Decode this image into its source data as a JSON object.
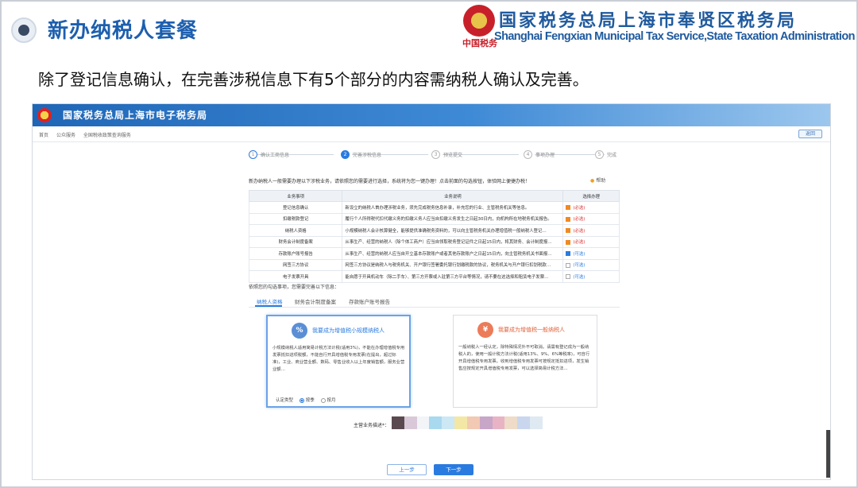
{
  "slide": {
    "title": "新办纳税人套餐",
    "org_cn": "国家税务总局上海市奉贤区税务局",
    "org_en": "Shanghai Fengxian Municipal Tax Service,State Taxation  Administration",
    "emblem_text": "中国税务",
    "description": "除了登记信息确认，在完善涉税信息下有5个部分的内容需纳税人确认及完善。"
  },
  "portal": {
    "banner_title": "国家税务总局上海市电子税务局",
    "breadcrumb": [
      "首页",
      "公众服务",
      "全国税收政策查询服务"
    ],
    "back_label": "返回",
    "steps": [
      {
        "num": "1",
        "label": "确认工商信息"
      },
      {
        "num": "2",
        "label": "完善涉税信息"
      },
      {
        "num": "3",
        "label": "预览提交"
      },
      {
        "num": "4",
        "label": "事项办理"
      },
      {
        "num": "5",
        "label": "完成"
      }
    ],
    "intro": "新办纳税人一般需要办理以下涉税业务，请依照您的需要进行选择，系统将为您一键办理！点击前面的勾选按钮，体验网上便捷办税！",
    "help_label": "帮助",
    "table": {
      "headers": [
        "业务事项",
        "业务说明",
        "选择办理"
      ],
      "rows": [
        {
          "item": "登记信息确认",
          "desc": "新设立的纳税人首办理涉税业务，须先完成税务信息补录，补充您的行业、主管税务机关等信息。",
          "status": "(必选)",
          "check": "orange",
          "required": true
        },
        {
          "item": "扣缴税款登记",
          "desc": "履行个人所得税代扣代缴义务的扣缴义务人应当自扣缴义务发生之日起30日内，向机构所在地税务机关报告。",
          "status": "(必选)",
          "check": "orange",
          "required": true
        },
        {
          "item": "纳税人资格",
          "desc": "小规模纳税人会计核算健全，能够提供准确税务资料的，可以向主管税务机关办理增值税一般纳税人登记…",
          "status": "(必选)",
          "check": "orange",
          "required": true
        },
        {
          "item": "财务会计制度备案",
          "desc": "从事生产、经营的纳税人（除个体工商户）应当自领取税务登记证件之日起15日内，将其财务、会计制度报…",
          "status": "(必选)",
          "check": "orange",
          "required": true
        },
        {
          "item": "存款账户账号报告",
          "desc": "从事生产、经营的纳税人应当自开立基本存款账户或者其他存款账户之日起15日内，向主管税务机关书面报…",
          "status": "(可选)",
          "check": "blue",
          "required": false
        },
        {
          "item": "网签三方协议",
          "desc": "网签三方协议是纳税人与税务机关、开户银行签署委托银行划缴税款的协议，税务机关与开户银行扣划税款…",
          "status": "(可选)",
          "check": "none",
          "required": false
        },
        {
          "item": "电子发票开具",
          "desc": "能自愿于开具机动车（除二手车）、第三方开票或入驻第三方平台等情况，请不要在这选择和租赁电子发票…",
          "status": "(可选)",
          "check": "none",
          "required": false
        }
      ]
    },
    "hint": "依照您的勾选事项，您需要完善以下信息：",
    "tabs": [
      "纳税人资格",
      "财务会计制度备案",
      "存款账户账号报告"
    ],
    "cards": [
      {
        "icon": "small-scale-taxpayer-icon",
        "title": "我要成为增值税小规模纳税人",
        "body": "小规模纳税人适用简易计税方法计税(适用3%)，不能在办理增值税专用发票抵扣进项税额，不能自行开具增值税专用发票(在提出，超过标准)，工业、商业营业额、数码、零售业收入以上年度销售额，服务业营业额…",
        "foot_label": "认定类型",
        "options": [
          "按季",
          "按月"
        ]
      },
      {
        "icon": "general-taxpayer-icon",
        "title": "我要成为增值税一般纳税人",
        "body": "一般纳税人一经认定，除特殊情况外不可取消。请需有登记成为一般纳税人的，使用一般计税方法计税(适用13%、9%、6%等税率)，可自行开具增值税专用发票。收到增值税专用发票可按规定抵扣进项，发生销售应按规定开具增值税专用发票，可以选择简易计税方法…"
      }
    ],
    "main_business_label": "主营业务描述*：",
    "prev_label": "上一步",
    "next_label": "下一步",
    "colors": {
      "primary": "#2a7be0",
      "required": "#d33333",
      "banner": "#1f66b7",
      "title_blue": "#1d5fae",
      "orange": "#f08a24"
    }
  }
}
